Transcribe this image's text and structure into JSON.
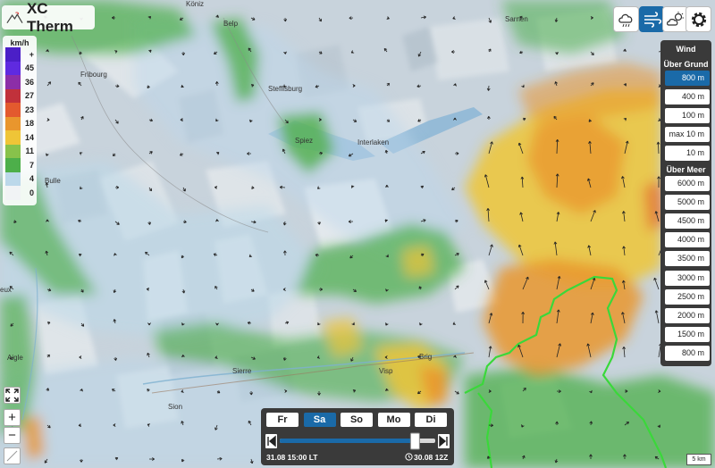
{
  "app": {
    "title": "XC Therm"
  },
  "legend": {
    "unit": "km/h",
    "rows": [
      {
        "label": "+",
        "color": "#4b1fc7"
      },
      {
        "label": "45",
        "color": "#5f2ae0"
      },
      {
        "label": "36",
        "color": "#8c2ea8"
      },
      {
        "label": "27",
        "color": "#c1313b"
      },
      {
        "label": "23",
        "color": "#e35a2e"
      },
      {
        "label": "18",
        "color": "#e9962d"
      },
      {
        "label": "14",
        "color": "#efc537"
      },
      {
        "label": "11",
        "color": "#88c24b"
      },
      {
        "label": "7",
        "color": "#4daf4a"
      },
      {
        "label": "4",
        "color": "#bcd8ea"
      },
      {
        "label": "0",
        "color": "#f1f3f5"
      }
    ]
  },
  "toolbar": {
    "buttons": [
      {
        "icon": "weather-cloud-icon"
      },
      {
        "icon": "wind-icon",
        "active": true
      },
      {
        "icon": "sun-cloud-icon"
      },
      {
        "icon": "gear-icon"
      }
    ]
  },
  "height_panel": {
    "heading": "Wind",
    "group_above_ground": "Über Grund",
    "above_ground": [
      "800 m",
      "400 m",
      "100 m",
      "max 10 m",
      "10 m"
    ],
    "active": "800 m",
    "group_above_sea": "Über Meer",
    "above_sea": [
      "6000 m",
      "5000 m",
      "4500 m",
      "4000 m",
      "3500 m",
      "3000 m",
      "2500 m",
      "2000 m",
      "1500 m",
      "800 m"
    ]
  },
  "zoom": {
    "fullscreen_icon": "fullscreen-icon",
    "in": "+",
    "out": "−"
  },
  "days": {
    "items": [
      "Fr",
      "Sa",
      "So",
      "Mo",
      "Di"
    ],
    "active": "Sa",
    "slider_progress": 0.87
  },
  "time": {
    "local": "31.08 15:00 LT",
    "model": "30.08 12Z"
  },
  "map": {
    "towns": [
      "Köniz",
      "Belp",
      "Sarnen",
      "Fribourg",
      "Steffisburg",
      "Spiez",
      "Interlaken",
      "Bulle",
      "Aigle",
      "Sierre",
      "Visp",
      "Brig",
      "Sion",
      "eux"
    ],
    "scale": "5 km"
  }
}
